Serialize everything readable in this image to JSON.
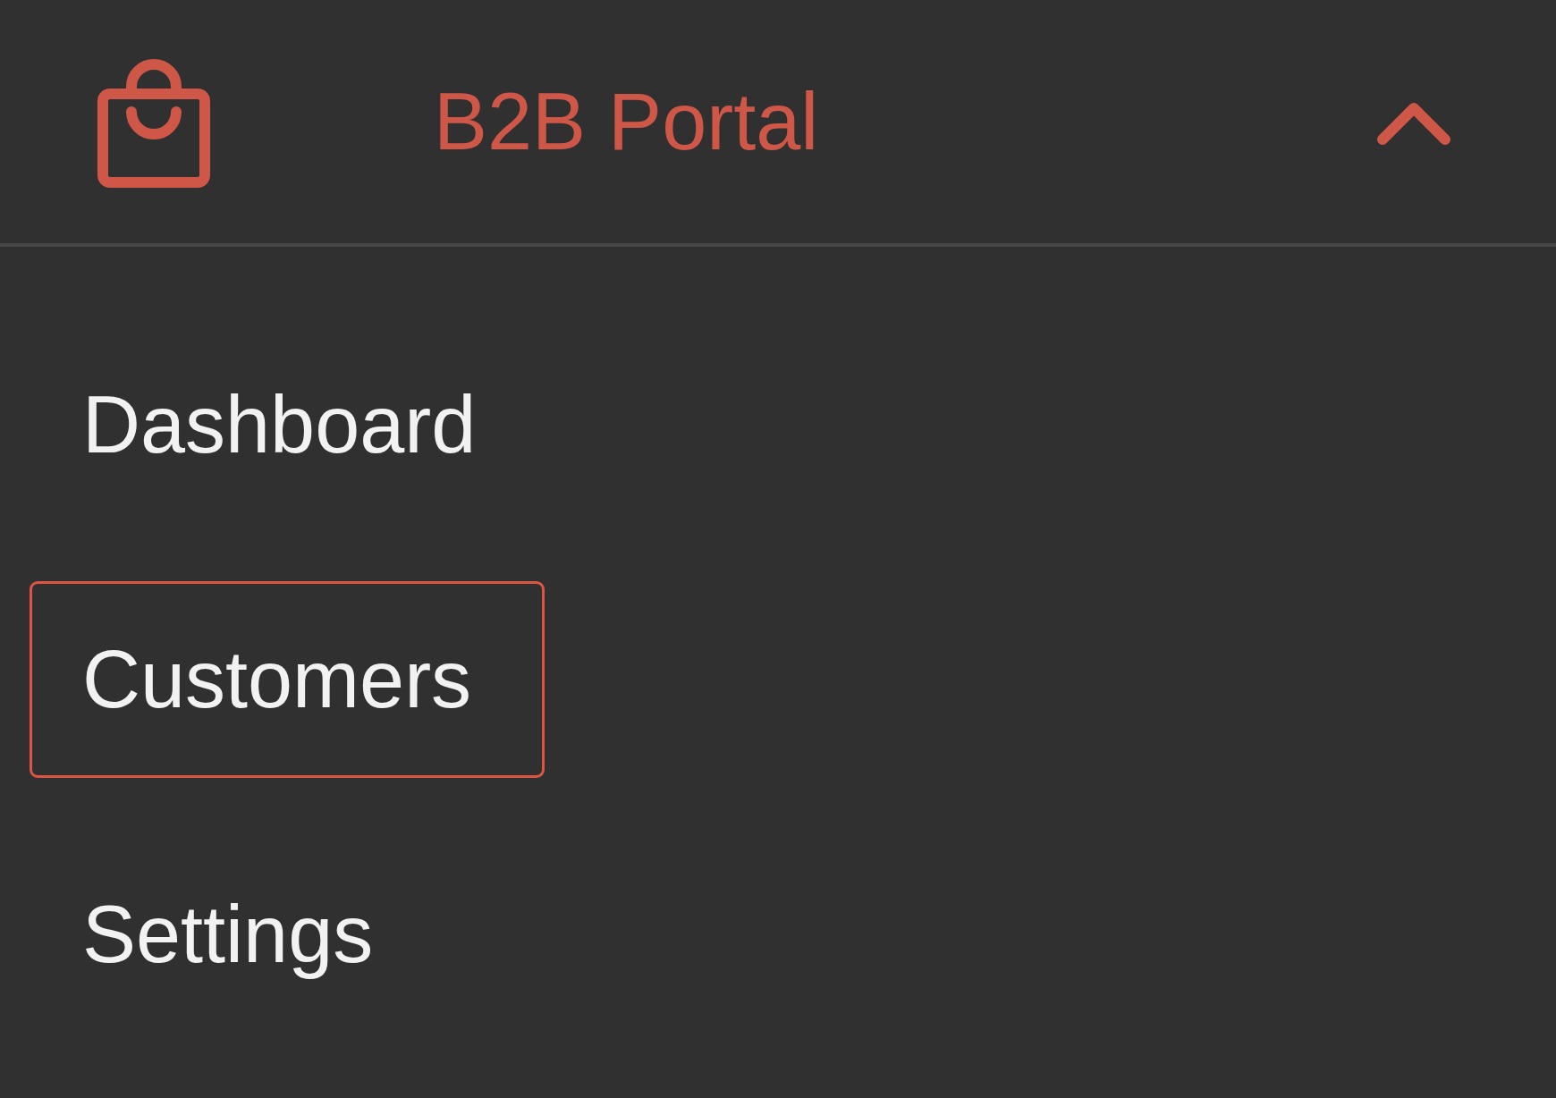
{
  "header": {
    "title": "B2B Portal",
    "expanded": true
  },
  "menu": [
    {
      "label": "Dashboard",
      "selected": false
    },
    {
      "label": "Customers",
      "selected": true
    },
    {
      "label": "Settings",
      "selected": false
    }
  ]
}
